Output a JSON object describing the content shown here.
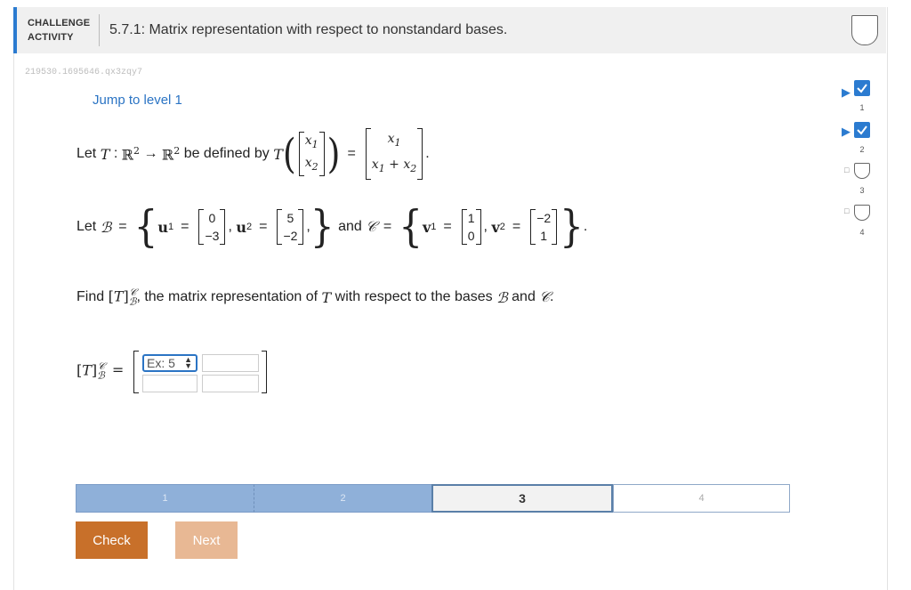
{
  "header": {
    "label_line1": "CHALLENGE",
    "label_line2": "ACTIVITY",
    "title": "5.7.1: Matrix representation with respect to nonstandard bases."
  },
  "activity_id": "219530.1695646.qx3zqy7",
  "jump_link": "Jump to level 1",
  "problem": {
    "let": "Let",
    "defined_by": "be defined by",
    "and": "and",
    "find": "Find",
    "find_rest": ", the matrix representation of",
    "with_respect": "with respect to the bases",
    "and2": "and",
    "u1": [
      "0",
      "−3"
    ],
    "u2": [
      "5",
      "−2"
    ],
    "v1": [
      "1",
      "0"
    ],
    "v2": [
      "−2",
      "1"
    ]
  },
  "answer": {
    "placeholder": "Ex: 5"
  },
  "progress": {
    "levels": [
      "1",
      "2",
      "3",
      "4"
    ],
    "current": "3"
  },
  "buttons": {
    "check": "Check",
    "next": "Next"
  },
  "sidebar": {
    "items": [
      {
        "num": "1",
        "status": "done"
      },
      {
        "num": "2",
        "status": "done"
      },
      {
        "num": "3",
        "status": "todo"
      },
      {
        "num": "4",
        "status": "todo"
      }
    ]
  },
  "colors": {
    "accent": "#2b7bd0",
    "check_button": "#c8702a",
    "next_button": "#e8b894",
    "progress_done": "#8fb0d9"
  }
}
